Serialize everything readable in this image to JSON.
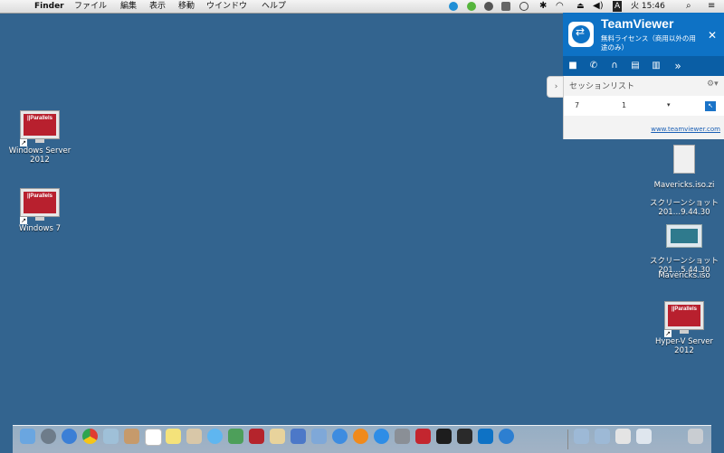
{
  "menubar": {
    "apple_glyph": "",
    "app": "Finder",
    "items": [
      "ファイル",
      "編集",
      "表示",
      "移動",
      "ウインドウ",
      "ヘルプ"
    ],
    "clock": "火 15:46",
    "input_indicator": "A",
    "status_icons": [
      "skype-icon",
      "evernote-icon",
      "cloud-icon",
      "backup-icon",
      "time-machine-icon",
      "bluetooth-icon",
      "wifi-icon",
      "eject-icon",
      "volume-icon"
    ]
  },
  "desktop": {
    "left_icons": [
      {
        "label": "Windows Server 2012",
        "icon": "parallels-vm-icon"
      },
      {
        "label": "Windows 7",
        "icon": "parallels-vm-icon"
      }
    ],
    "right_icons": [
      {
        "label": "Mavericks.iso.zi",
        "icon": "zip-archive-icon"
      },
      {
        "label": "スクリーンショット 201…9.44.30",
        "icon": "screenshot-file-icon"
      },
      {
        "label": "スクリーンショット 201…5.44.30",
        "icon": "screenshot-file-icon"
      },
      {
        "label": "Mavericks.iso",
        "icon": "disk-image-icon"
      },
      {
        "label": "Hyper-V Server 2012",
        "icon": "parallels-vm-icon"
      }
    ],
    "parallels_brand": "||Parallels"
  },
  "teamviewer": {
    "title": "TeamViewer",
    "subtitle": "無料ライセンス（商用以外の用途のみ）",
    "close_glyph": "✕",
    "toolbar_icons": [
      "video-icon",
      "phone-icon",
      "headset-icon",
      "chat-icon",
      "files-icon",
      "more-icon"
    ],
    "more_glyph": "»",
    "session_title": "セッションリスト",
    "gear_glyph": "⚙▾",
    "row": {
      "id": "7",
      "count": "1",
      "dropdown": "▾"
    },
    "link": "www.teamviewer.com"
  },
  "dock": {
    "apps": [
      "finder-icon",
      "launchpad-icon",
      "safari-icon",
      "chrome-icon",
      "preview-icon",
      "contacts-icon",
      "calendar-icon",
      "stickies-icon",
      "photos-icon",
      "messages-icon",
      "facetime-icon",
      "photo-booth-icon",
      "notes-icon",
      "xcode-icon",
      "mail-icon",
      "itunes-icon",
      "ibooks-icon",
      "app-store-icon",
      "system-preferences-icon",
      "parallels-icon",
      "terminal-icon",
      "activity-monitor-icon",
      "teamviewer-icon",
      "onedrive-icon"
    ],
    "right": [
      "documents-folder-icon",
      "downloads-folder-icon",
      "screenshots-stack-icon",
      "applications-stack-icon",
      "trash-icon"
    ]
  },
  "colors": {
    "desktop": "#33648f",
    "teamviewer_blue": "#0e72c5",
    "parallels_red": "#b8202e"
  }
}
